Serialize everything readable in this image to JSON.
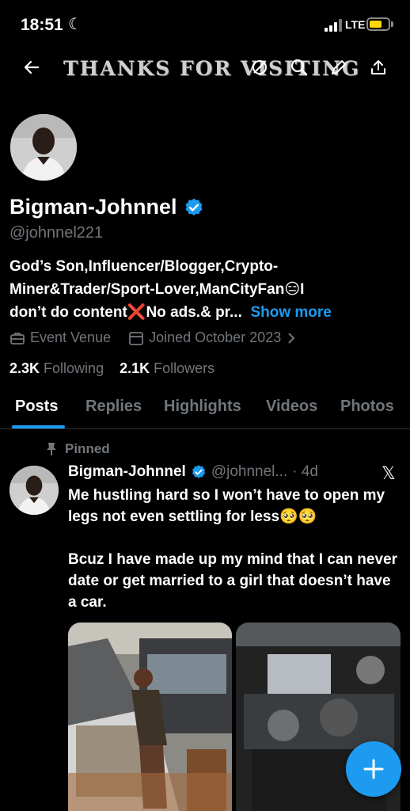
{
  "status": {
    "time": "18:51",
    "network": "LTE",
    "battery_level": 0.55
  },
  "header": {
    "banner_text": "THANKS FOR VISITING",
    "back_icon": "arrow-left-icon",
    "actions": [
      "incognito-icon",
      "search-icon",
      "edit-icon",
      "share-icon"
    ]
  },
  "profile": {
    "name": "Bigman-Johnnel",
    "handle": "@johnnel221",
    "verified": true,
    "bio_line1": "God’s Son,Influencer/Blogger,Crypto-",
    "bio_line2": "Miner&Trader/Sport-Lover,ManCityFan😑I",
    "bio_line3": "don’t do content❌No ads.& pr...",
    "show_more": "Show more",
    "location": "Event Venue",
    "joined": "Joined October 2023",
    "following_count": "2.3K",
    "following_label": "Following",
    "followers_count": "2.1K",
    "followers_label": "Followers"
  },
  "tabs": [
    "Posts",
    "Replies",
    "Highlights",
    "Videos",
    "Photos"
  ],
  "post": {
    "pinned_label": "Pinned",
    "author": "Bigman-Johnnel",
    "handle": "@johnnel...",
    "time": "· 4d",
    "para1": "Me hustling hard so I won’t have to open my legs not even settling for less🥺🥺",
    "para2": "Bcuz I have made up my mind that I can never date or get married to a girl that doesn’t have a car."
  },
  "colors": {
    "accent": "#1d9bf0",
    "background": "#000000",
    "muted": "#71767b"
  }
}
